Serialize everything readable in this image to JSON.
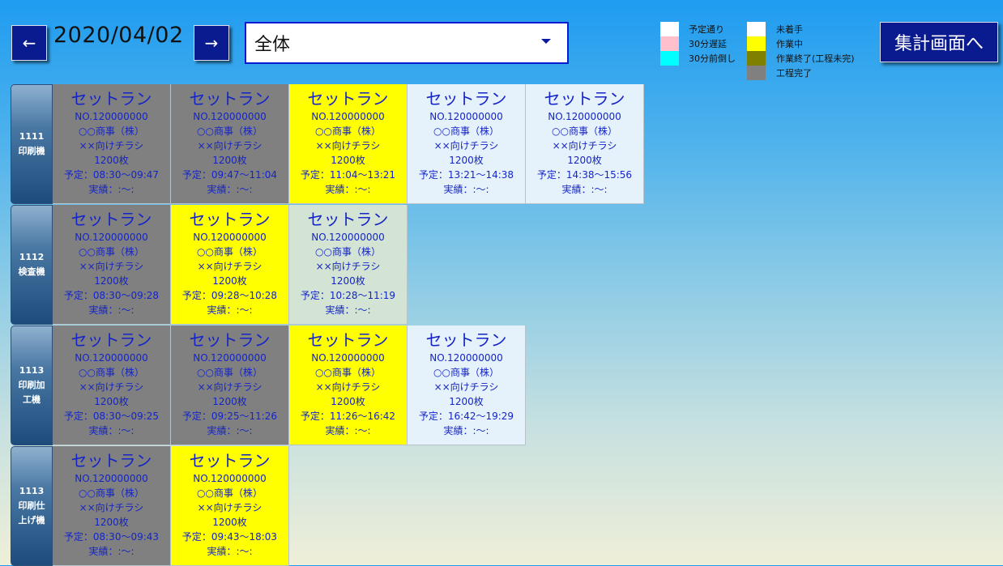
{
  "header": {
    "prev_label": "←",
    "next_label": "→",
    "date": "2020/04/02",
    "filter_value": "全体",
    "summary_label": "集計画面へ"
  },
  "legend": {
    "left": [
      {
        "label": "予定通り",
        "color": "#ffffff"
      },
      {
        "label": "30分遅延",
        "color": "#ffc0cb"
      },
      {
        "label": "30分前倒し",
        "color": "#00ffff"
      }
    ],
    "right": [
      {
        "label": "未着手",
        "color": "#ffffff"
      },
      {
        "label": "作業中",
        "color": "#ffff00"
      },
      {
        "label": "作業終了(工程未完)",
        "color": "#808000"
      },
      {
        "label": "工程完了",
        "color": "#808080"
      }
    ]
  },
  "rows": [
    {
      "id": "1111",
      "name_lines": [
        "印刷機"
      ],
      "cards": [
        {
          "title": "セットラン",
          "no": "NO.120000000",
          "company": "○○商事（株）",
          "item": "××向けチラシ",
          "qty": "1200枚",
          "plan": "予定：08:30〜09:47",
          "actual": "実績：:〜:",
          "bg": "#808080"
        },
        {
          "title": "セットラン",
          "no": "NO.120000000",
          "company": "○○商事（株）",
          "item": "××向けチラシ",
          "qty": "1200枚",
          "plan": "予定：09:47〜11:04",
          "actual": "実績：:〜:",
          "bg": "#808080"
        },
        {
          "title": "セットラン",
          "no": "NO.120000000",
          "company": "○○商事（株）",
          "item": "××向けチラシ",
          "qty": "1200枚",
          "plan": "予定：11:04〜13:21",
          "actual": "実績：:〜:",
          "bg": "#ffff00"
        },
        {
          "title": "セットラン",
          "no": "NO.120000000",
          "company": "○○商事（株）",
          "item": "××向けチラシ",
          "qty": "1200枚",
          "plan": "予定：13:21〜14:38",
          "actual": "実績：:〜:",
          "bg": "#e6f2fb"
        },
        {
          "title": "セットラン",
          "no": "NO.120000000",
          "company": "○○商事（株）",
          "item": "××向けチラシ",
          "qty": "1200枚",
          "plan": "予定：14:38〜15:56",
          "actual": "実績：:〜:",
          "bg": "#e6f2fb"
        }
      ]
    },
    {
      "id": "1112",
      "name_lines": [
        "検査機"
      ],
      "cards": [
        {
          "title": "セットラン",
          "no": "NO.120000000",
          "company": "○○商事（株）",
          "item": "××向けチラシ",
          "qty": "1200枚",
          "plan": "予定：08:30〜09:28",
          "actual": "実績：:〜:",
          "bg": "#808080"
        },
        {
          "title": "セットラン",
          "no": "NO.120000000",
          "company": "○○商事（株）",
          "item": "××向けチラシ",
          "qty": "1200枚",
          "plan": "予定：09:28〜10:28",
          "actual": "実績：:〜:",
          "bg": "#ffff00"
        },
        {
          "title": "セットラン",
          "no": "NO.120000000",
          "company": "○○商事（株）",
          "item": "××向けチラシ",
          "qty": "1200枚",
          "plan": "予定：10:28〜11:19",
          "actual": "実績：:〜:",
          "bg": "#d3e4d4"
        }
      ]
    },
    {
      "id": "1113",
      "name_lines": [
        "印刷加",
        "工機"
      ],
      "cards": [
        {
          "title": "セットラン",
          "no": "NO.120000000",
          "company": "○○商事（株）",
          "item": "××向けチラシ",
          "qty": "1200枚",
          "plan": "予定：08:30〜09:25",
          "actual": "実績：:〜:",
          "bg": "#808080"
        },
        {
          "title": "セットラン",
          "no": "NO.120000000",
          "company": "○○商事（株）",
          "item": "××向けチラシ",
          "qty": "1200枚",
          "plan": "予定：09:25〜11:26",
          "actual": "実績：:〜:",
          "bg": "#808080"
        },
        {
          "title": "セットラン",
          "no": "NO.120000000",
          "company": "○○商事（株）",
          "item": "××向けチラシ",
          "qty": "1200枚",
          "plan": "予定：11:26〜16:42",
          "actual": "実績：:〜:",
          "bg": "#ffff00"
        },
        {
          "title": "セットラン",
          "no": "NO.120000000",
          "company": "○○商事（株）",
          "item": "××向けチラシ",
          "qty": "1200枚",
          "plan": "予定：16:42〜19:29",
          "actual": "実績：:〜:",
          "bg": "#e6f2fb"
        }
      ]
    },
    {
      "id": "1113",
      "name_lines": [
        "印刷仕",
        "上げ機"
      ],
      "cards": [
        {
          "title": "セットラン",
          "no": "NO.120000000",
          "company": "○○商事（株）",
          "item": "××向けチラシ",
          "qty": "1200枚",
          "plan": "予定：08:30〜09:43",
          "actual": "実績：:〜:",
          "bg": "#808080"
        },
        {
          "title": "セットラン",
          "no": "NO.120000000",
          "company": "○○商事（株）",
          "item": "××向けチラシ",
          "qty": "1200枚",
          "plan": "予定：09:43〜18:03",
          "actual": "実績：:〜:",
          "bg": "#ffff00"
        }
      ]
    }
  ]
}
